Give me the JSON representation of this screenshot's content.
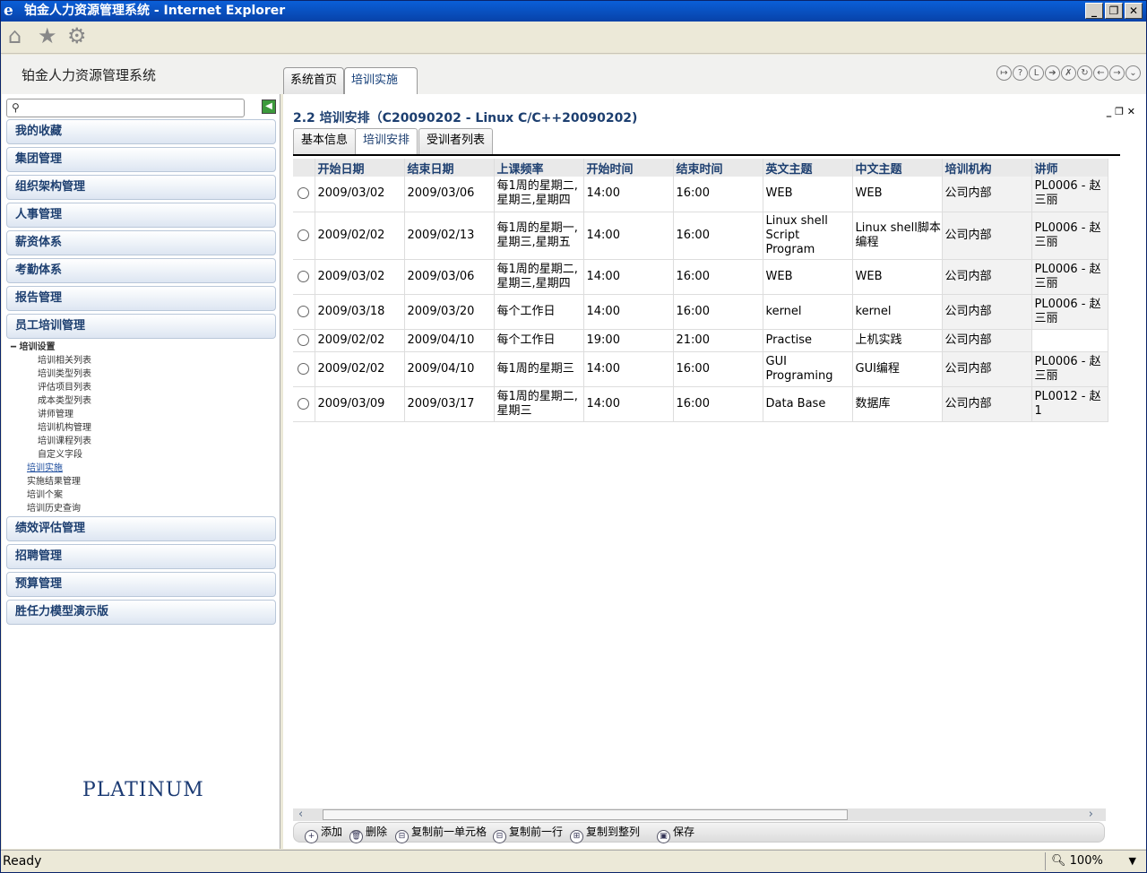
{
  "window": {
    "title": "铂金人力资源管理系统 - Internet Explorer"
  },
  "app": {
    "name": "铂金人力资源管理系统"
  },
  "top_tabs": [
    {
      "label": "系统首页"
    },
    {
      "label": "培训实施"
    }
  ],
  "sidebar": {
    "menus": [
      "我的收藏",
      "集团管理",
      "组织架构管理",
      "人事管理",
      "薪资体系",
      "考勤体系",
      "报告管理",
      "员工培训管理"
    ],
    "tree_group": "培训设置",
    "tree_children": [
      "培训相关列表",
      "培训类型列表",
      "评估项目列表",
      "成本类型列表",
      "讲师管理",
      "培训机构管理",
      "培训课程列表",
      "自定义字段"
    ],
    "tree_siblings": [
      "培训实施",
      "实施结果管理",
      "培训个案",
      "培训历史查询"
    ],
    "menus_after": [
      "绩效评估管理",
      "招聘管理",
      "预算管理",
      "胜任力模型演示版"
    ],
    "logo": "PLATINUM"
  },
  "page": {
    "title": "2.2 培训安排（C20090202 - Linux C/C++20090202)",
    "subtabs": [
      "基本信息",
      "培训安排",
      "受训者列表"
    ]
  },
  "table": {
    "columns": [
      "开始日期",
      "结束日期",
      "上课频率",
      "开始时间",
      "结束时间",
      "英文主题",
      "中文主题",
      "培训机构",
      "讲师"
    ],
    "rows": [
      [
        "2009/03/02",
        "2009/03/06",
        "每1周的星期二,星期三,星期四",
        "14:00",
        "16:00",
        "WEB",
        "WEB",
        "公司内部",
        "PL0006 - 赵三丽"
      ],
      [
        "2009/02/02",
        "2009/02/13",
        "每1周的星期一,星期三,星期五",
        "14:00",
        "16:00",
        "Linux shell Script Program",
        "Linux shell脚本编程",
        "公司内部",
        "PL0006 - 赵三丽"
      ],
      [
        "2009/03/02",
        "2009/03/06",
        "每1周的星期二,星期三,星期四",
        "14:00",
        "16:00",
        "WEB",
        "WEB",
        "公司内部",
        "PL0006 - 赵三丽"
      ],
      [
        "2009/03/18",
        "2009/03/20",
        "每个工作日",
        "14:00",
        "16:00",
        "kernel",
        "kernel",
        "公司内部",
        "PL0006 - 赵三丽"
      ],
      [
        "2009/02/02",
        "2009/04/10",
        "每个工作日",
        "19:00",
        "21:00",
        "Practise",
        "上机实践",
        "公司内部",
        ""
      ],
      [
        "2009/02/02",
        "2009/04/10",
        "每1周的星期三",
        "14:00",
        "16:00",
        "GUI Programing",
        "GUI编程",
        "公司内部",
        "PL0006 - 赵三丽"
      ],
      [
        "2009/03/09",
        "2009/03/17",
        "每1周的星期二,星期三",
        "14:00",
        "16:00",
        "Data Base",
        "数据库",
        "公司内部",
        "PL0012 - 赵1"
      ]
    ]
  },
  "buttons": [
    "添加",
    "删除",
    "复制前一单元格",
    "复制前一行",
    "复制到整列",
    "保存"
  ],
  "status": {
    "text": "Ready",
    "zoom": "100%"
  }
}
